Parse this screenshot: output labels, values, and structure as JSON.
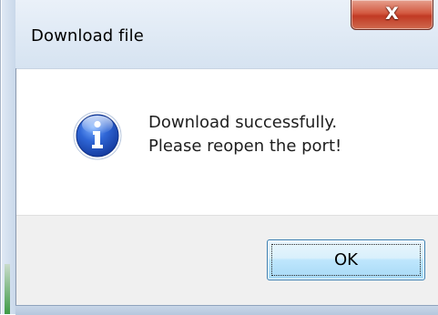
{
  "window": {
    "title": "Download file",
    "close_glyph": "X"
  },
  "message": {
    "icon": "information-icon",
    "line1": "Download successfully.",
    "line2": "Please reopen the port!"
  },
  "buttons": {
    "ok_label": "OK"
  },
  "colors": {
    "close_button": "#c83c26",
    "ok_button_border": "#3c7fb1",
    "icon_blue": "#1c4fb4",
    "footer_bg": "#f0f0f0"
  }
}
